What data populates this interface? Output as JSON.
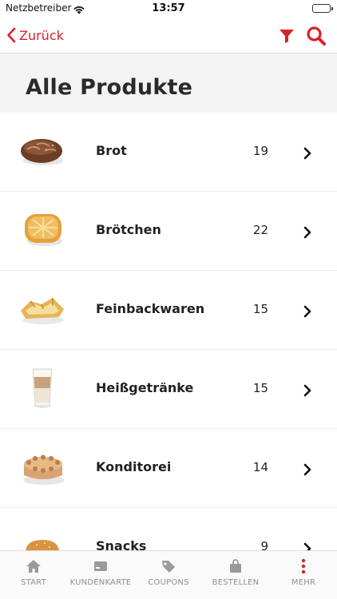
{
  "status_bar": {
    "carrier": "Netzbetreiber",
    "time": "13:57"
  },
  "nav": {
    "back_label": "Zurück"
  },
  "page": {
    "title": "Alle Produkte"
  },
  "products": [
    {
      "name": "Brot",
      "count": "19",
      "icon": "bread-icon"
    },
    {
      "name": "Brötchen",
      "count": "22",
      "icon": "roll-icon"
    },
    {
      "name": "Feinbackwaren",
      "count": "15",
      "icon": "pastry-icon"
    },
    {
      "name": "Heißgetränke",
      "count": "15",
      "icon": "latte-icon"
    },
    {
      "name": "Konditorei",
      "count": "14",
      "icon": "cake-icon"
    },
    {
      "name": "Snacks",
      "count": "9",
      "icon": "burger-icon"
    }
  ],
  "tabs": [
    {
      "label": "START",
      "icon": "home-icon"
    },
    {
      "label": "KUNDENKARTE",
      "icon": "card-icon"
    },
    {
      "label": "COUPONS",
      "icon": "tag-icon"
    },
    {
      "label": "BESTELLEN",
      "icon": "bag-icon"
    },
    {
      "label": "MEHR",
      "icon": "more-icon"
    }
  ],
  "colors": {
    "accent": "#d6222a",
    "header_bg": "#f3f3f3",
    "tab_icon": "#9a9a9a"
  }
}
